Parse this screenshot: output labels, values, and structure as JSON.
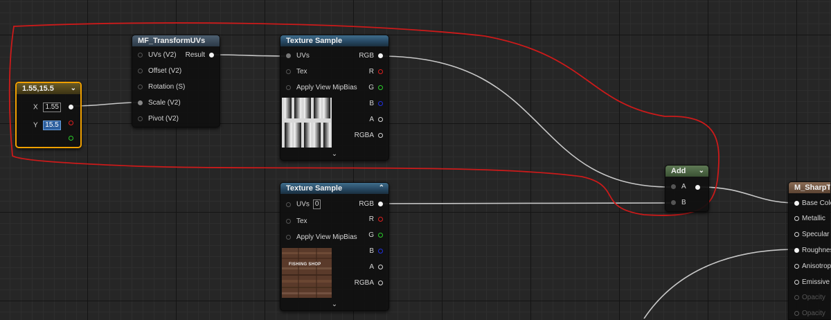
{
  "colors": {
    "annotation": "#cc1a1a",
    "selected_border": "#f0a000",
    "wire": "#c8c8c8"
  },
  "constant_node": {
    "title": "1.55,15.5",
    "x_label": "X",
    "x_value": "1.55",
    "y_label": "Y",
    "y_value": "15.5"
  },
  "transform_node": {
    "title": "MF_TransformUVs",
    "inputs": [
      "UVs (V2)",
      "Offset (V2)",
      "Rotation (S)",
      "Scale (V2)",
      "Pivot (V2)"
    ],
    "output": "Result"
  },
  "texture_sample_1": {
    "title": "Texture Sample",
    "inputs": [
      "UVs",
      "Tex",
      "Apply View MipBias"
    ],
    "outputs": [
      "RGB",
      "R",
      "G",
      "B",
      "A",
      "RGBA"
    ]
  },
  "texture_sample_2": {
    "title": "Texture Sample",
    "inputs": [
      "UVs",
      "Tex",
      "Apply View MipBias"
    ],
    "uvs_value": "0",
    "outputs": [
      "RGB",
      "R",
      "G",
      "B",
      "A",
      "RGBA"
    ],
    "preview_text": "FISHING SHOP"
  },
  "add_node": {
    "title": "Add",
    "inputs": [
      "A",
      "B"
    ]
  },
  "material_node": {
    "title": "M_SharpTex",
    "inputs": [
      "Base Color",
      "Metallic",
      "Specular",
      "Roughness",
      "Anisotropy",
      "Emissive",
      "Opacity",
      "Opacity"
    ]
  },
  "icons": {
    "collapse": "chevron-down-icon",
    "expand": "chevron-up-icon",
    "more": "chevron-down-icon"
  }
}
